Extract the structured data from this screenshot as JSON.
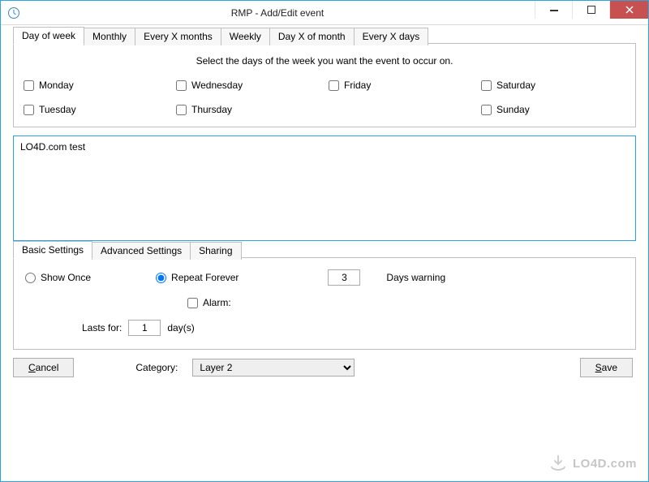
{
  "window": {
    "title": "RMP - Add/Edit event"
  },
  "schedule_tabs": {
    "items": [
      {
        "label": "Day of week",
        "active": true
      },
      {
        "label": "Monthly",
        "active": false
      },
      {
        "label": "Every X months",
        "active": false
      },
      {
        "label": "Weekly",
        "active": false
      },
      {
        "label": "Day X of month",
        "active": false
      },
      {
        "label": "Every X days",
        "active": false
      }
    ],
    "instruction": "Select the days of the week you want the event to occur on.",
    "days": [
      {
        "label": "Monday",
        "checked": false
      },
      {
        "label": "Wednesday",
        "checked": false
      },
      {
        "label": "Friday",
        "checked": false
      },
      {
        "label": "Saturday",
        "checked": false
      },
      {
        "label": "Tuesday",
        "checked": false
      },
      {
        "label": "Thursday",
        "checked": false
      },
      {
        "label": "",
        "checked": false,
        "hidden": true
      },
      {
        "label": "Sunday",
        "checked": false
      }
    ]
  },
  "event_text": "LO4D.com test",
  "settings_tabs": {
    "items": [
      {
        "label": "Basic Settings",
        "active": true
      },
      {
        "label": "Advanced Settings",
        "active": false
      },
      {
        "label": "Sharing",
        "active": false
      }
    ]
  },
  "basic": {
    "show_once_label": "Show Once",
    "repeat_forever_label": "Repeat Forever",
    "repeat_selected": "repeat",
    "days_warning_value": "3",
    "days_warning_label": "Days warning",
    "alarm_label": "Alarm:",
    "alarm_checked": false,
    "lasts_for_label": "Lasts for:",
    "lasts_for_value": "1",
    "lasts_for_unit": "day(s)"
  },
  "footer": {
    "cancel_label": "Cancel",
    "category_label": "Category:",
    "category_value": "Layer 2",
    "save_label": "Save"
  },
  "watermark": "LO4D.com"
}
